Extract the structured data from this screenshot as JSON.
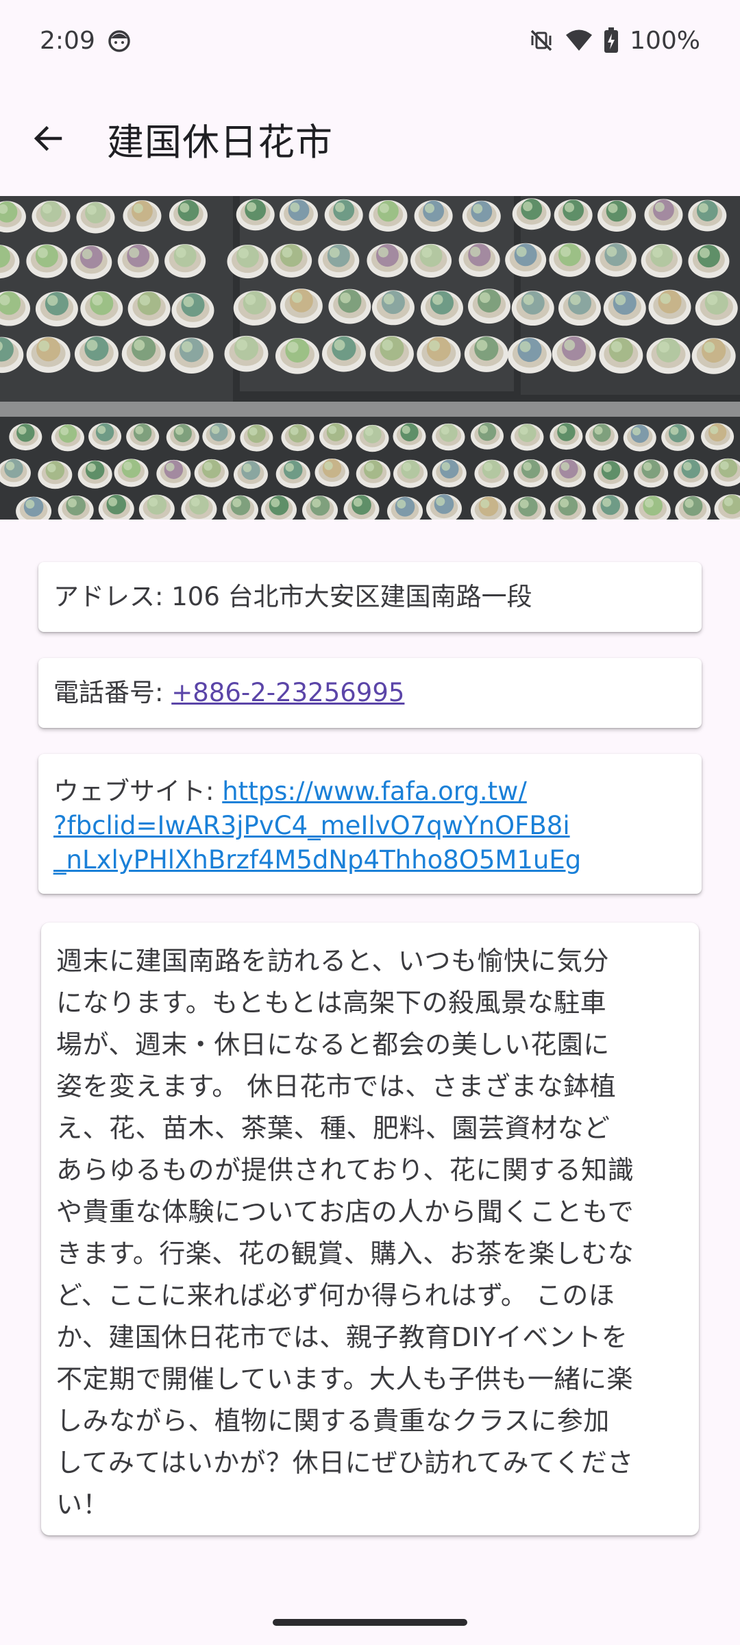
{
  "status_bar": {
    "time": "2:09",
    "battery": "100%",
    "icons": [
      "face-notification-icon",
      "vibrate-off-icon",
      "wifi-icon",
      "battery-charging-icon"
    ]
  },
  "app_bar": {
    "title": "建国休日花市",
    "back_icon": "arrow-left-icon"
  },
  "hero_image": {
    "subject": "succulent-pots-icon"
  },
  "address": {
    "label": "アドレス: ",
    "value": "106 台北市大安区建国南路一段"
  },
  "phone": {
    "label": "電話番号: ",
    "value": "+886-2-23256995"
  },
  "website": {
    "label": "ウェブサイト: ",
    "line1": "https://www.fafa.org.tw/",
    "line2": "?fbclid=IwAR3jPvC4_meIlvO7qwYnOFB8i",
    "line3": "_nLxlyPHlXhBrzf4M5dNp4Thho8O5M1uEg"
  },
  "description": {
    "lines": [
      "週末に建国南路を訪れると、いつも愉快に気分",
      "になります。もともとは高架下の殺風景な駐車",
      "場が、週末・休日になると都会の美しい花園に",
      "姿を変えます。 休日花市では、さまざまな鉢植",
      "え、花、苗木、茶葉、種、肥料、園芸資材など",
      "あらゆるものが提供されており、花に関する知識",
      "や貴重な体験についてお店の人から聞くこともで",
      "きます。行楽、花の観賞、購入、お茶を楽しむな",
      "ど、ここに来れば必ず何か得られはず。 このほ",
      "か、建国休日花市では、親子教育DIYイベントを",
      "不定期で開催しています。大人も子供も一緒に楽",
      "しみながら、植物に関する貴重なクラスに参加",
      "してみてはいかが？休日にぜひ訪れてみてくださ",
      "い！"
    ]
  },
  "colors": {
    "background": "#fdf7fd",
    "phone_link": "#5b45a8",
    "web_link": "#1a80d8"
  }
}
